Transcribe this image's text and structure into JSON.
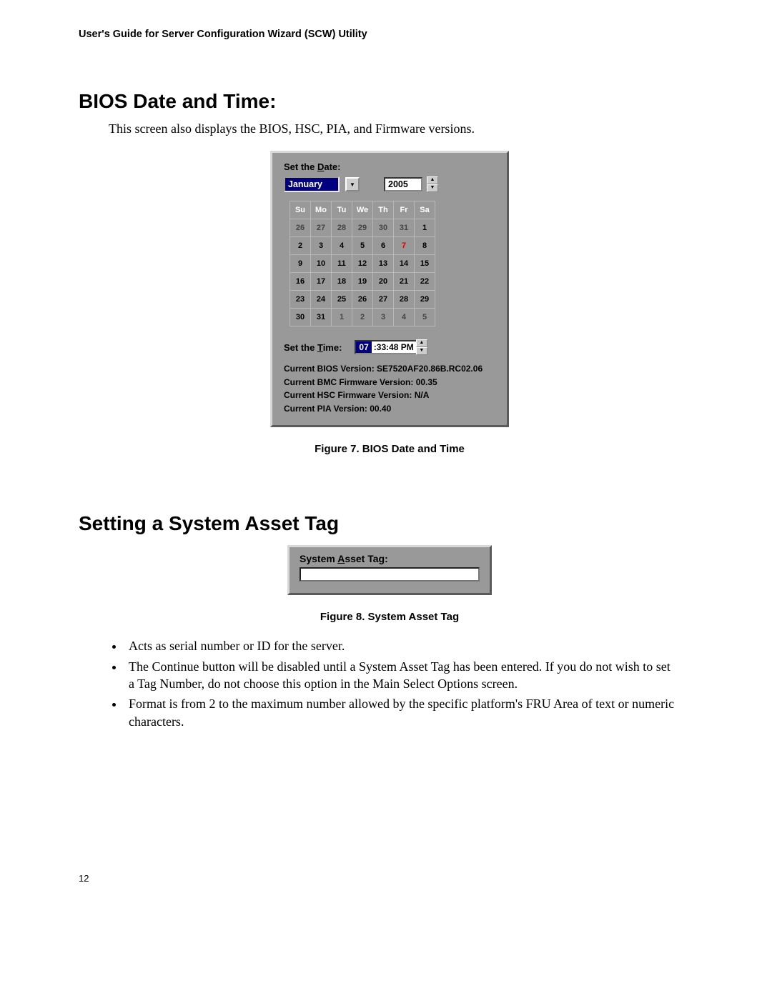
{
  "header": "User's Guide for Server Configuration Wizard (SCW) Utility",
  "section1": {
    "title": "BIOS Date and Time:",
    "intro": "This screen also displays the BIOS, HSC, PIA, and Firmware versions.",
    "figure_caption": "Figure 7.  BIOS Date and Time"
  },
  "bios_panel": {
    "set_date_label_pre": "Set the ",
    "set_date_label_u": "D",
    "set_date_label_post": "ate:",
    "month": "January",
    "year": "2005",
    "day_headers": [
      "Su",
      "Mo",
      "Tu",
      "We",
      "Th",
      "Fr",
      "Sa"
    ],
    "weeks": [
      [
        {
          "v": "26",
          "dim": true
        },
        {
          "v": "27",
          "dim": true
        },
        {
          "v": "28",
          "dim": true
        },
        {
          "v": "29",
          "dim": true
        },
        {
          "v": "30",
          "dim": true
        },
        {
          "v": "31",
          "dim": true
        },
        {
          "v": "1"
        }
      ],
      [
        {
          "v": "2"
        },
        {
          "v": "3"
        },
        {
          "v": "4"
        },
        {
          "v": "5"
        },
        {
          "v": "6"
        },
        {
          "v": "7",
          "today": true
        },
        {
          "v": "8"
        }
      ],
      [
        {
          "v": "9"
        },
        {
          "v": "10"
        },
        {
          "v": "11"
        },
        {
          "v": "12"
        },
        {
          "v": "13"
        },
        {
          "v": "14"
        },
        {
          "v": "15"
        }
      ],
      [
        {
          "v": "16"
        },
        {
          "v": "17"
        },
        {
          "v": "18"
        },
        {
          "v": "19"
        },
        {
          "v": "20"
        },
        {
          "v": "21"
        },
        {
          "v": "22"
        }
      ],
      [
        {
          "v": "23"
        },
        {
          "v": "24"
        },
        {
          "v": "25"
        },
        {
          "v": "26"
        },
        {
          "v": "27"
        },
        {
          "v": "28"
        },
        {
          "v": "29"
        }
      ],
      [
        {
          "v": "30"
        },
        {
          "v": "31"
        },
        {
          "v": "1",
          "dim": true
        },
        {
          "v": "2",
          "dim": true
        },
        {
          "v": "3",
          "dim": true
        },
        {
          "v": "4",
          "dim": true
        },
        {
          "v": "5",
          "dim": true
        }
      ]
    ],
    "set_time_label_pre": "Set the ",
    "set_time_label_u": "T",
    "set_time_label_post": "ime:",
    "time_hh": "07",
    "time_rest": ":33:48 PM",
    "versions": {
      "bios": "Current BIOS Version: SE7520AF20.86B.RC02.06",
      "bmc": "Current BMC Firmware Version: 00.35",
      "hsc": "Current HSC Firmware Version: N/A",
      "pia": "Current PIA Version: 00.40"
    }
  },
  "section2": {
    "title": "Setting a System Asset Tag",
    "figure_caption": "Figure 8.  System Asset Tag"
  },
  "asset_panel": {
    "label_pre": "System ",
    "label_u": "A",
    "label_post": "sset Tag:"
  },
  "bullets": [
    "Acts as serial number or ID for the server.",
    "The Continue button will be disabled until a System Asset Tag has been entered. If you do not wish to set a Tag Number, do not choose this option in the Main Select Options screen.",
    "Format is from 2 to the maximum number allowed by the specific platform's FRU Area of text or numeric characters."
  ],
  "page_number": "12"
}
